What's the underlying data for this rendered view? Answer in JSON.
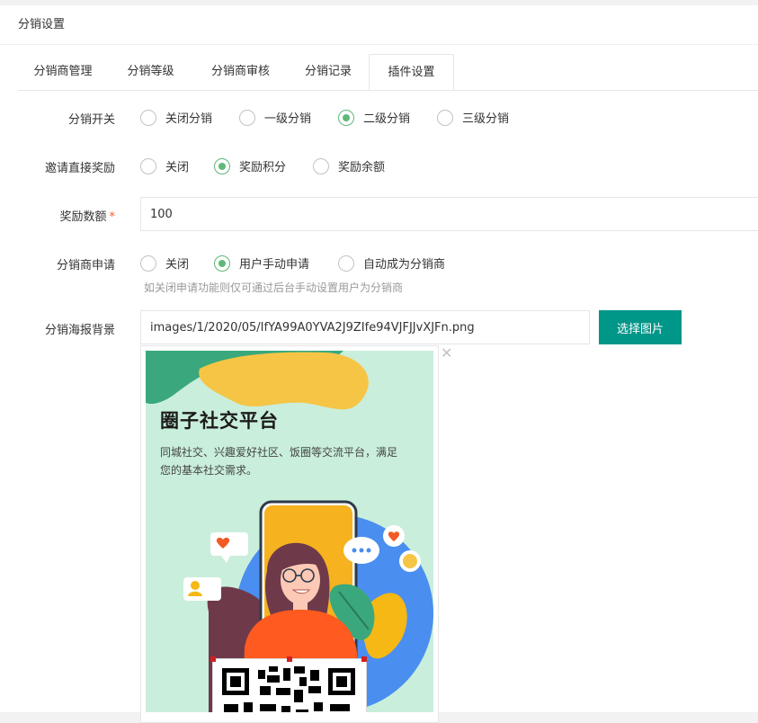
{
  "page_title": "分销设置",
  "tabs": [
    {
      "label": "分销商管理"
    },
    {
      "label": "分销等级"
    },
    {
      "label": "分销商审核"
    },
    {
      "label": "分销记录"
    },
    {
      "label": "插件设置",
      "active": true
    }
  ],
  "form": {
    "distribution_switch": {
      "label": "分销开关",
      "options": [
        "关闭分销",
        "一级分销",
        "二级分销",
        "三级分销"
      ],
      "selected": "二级分销"
    },
    "invite_reward": {
      "label": "邀请直接奖励",
      "options": [
        "关闭",
        "奖励积分",
        "奖励余额"
      ],
      "selected": "奖励积分"
    },
    "reward_amount": {
      "label": "奖励数额",
      "required_mark": "*",
      "value": "100"
    },
    "distributor_apply": {
      "label": "分销商申请",
      "options": [
        "关闭",
        "用户手动申请",
        "自动成为分销商"
      ],
      "selected": "用户手动申请",
      "hint": "如关闭申请功能则仅可通过后台手动设置用户为分销商"
    },
    "poster_bg": {
      "label": "分销海报背景",
      "value": "images/1/2020/05/IfYA99A0YVA2J9ZIfe94VJFJJvXJFn.png",
      "button_label": "选择图片",
      "remove_glyph": "✕"
    }
  },
  "poster": {
    "title": "圈子社交平台",
    "subtitle": "同城社交、兴趣爱好社区、饭圈等交流平台，满足您的基本社交需求。"
  },
  "colors": {
    "accent": "#009688",
    "radio_checked": "#5fb878",
    "required": "#ff5722",
    "poster_bg": "#c9eedb"
  }
}
